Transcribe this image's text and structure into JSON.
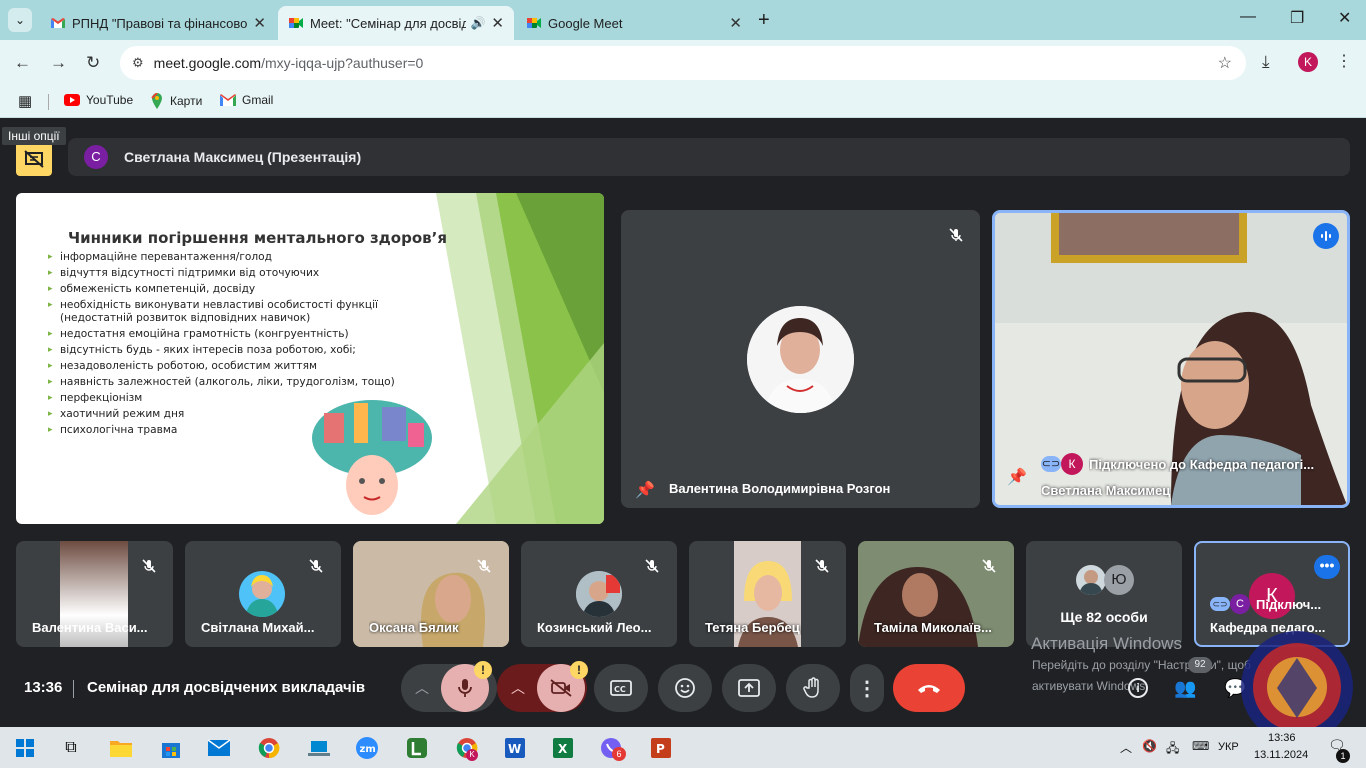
{
  "browser": {
    "tabs": [
      {
        "title": "РПНД \"Правові та фінансово-...",
        "favicon": "gmail-icon"
      },
      {
        "title": "Meet: \"Семінар для досвід",
        "favicon": "meet-icon",
        "audio": true
      },
      {
        "title": "Google Meet",
        "favicon": "meet-icon"
      }
    ],
    "url_host": "meet.google.com",
    "url_path": "/mxy-iqqa-ujp?authuser=0",
    "profile_letter": "K",
    "bookmarks": [
      {
        "label": "YouTube",
        "icon": "youtube-icon"
      },
      {
        "label": "Карти",
        "icon": "maps-icon"
      },
      {
        "label": "Gmail",
        "icon": "gmail-icon"
      }
    ],
    "tooltip": "Інші опції"
  },
  "meet": {
    "presenter_avatar": "С",
    "presenter_label": "Светлана Максимец (Презентація)",
    "slide": {
      "title": "Чинники погіршення ментального здоров’я",
      "items": [
        "інформаційне перевантаження/голод",
        "відчуття відсутності підтримки від оточуючих",
        "обмеженість компетенцій, досвіду",
        "необхідність виконувати невластиві особистості функції  (недостатній розвиток відповідних навичок)",
        "недостатня емоційна грамотність (конгруентність)",
        "відсутність будь - яких інтересів поза роботою, хобі;",
        "незадоволеність роботою, особистим життям",
        "наявність залежностей (алкоголь, ліки, трудоголізм, тощо)",
        "перфекціонізм",
        "хаотичний режим дня",
        "психологічна травма"
      ]
    },
    "main_tiles": [
      {
        "name": "Валентина Володимирівна Розгон"
      },
      {
        "name": "Светлана Максимец",
        "status": "Підключено до Кафедра педагогі...",
        "status_avatar": "К"
      }
    ],
    "strip": [
      {
        "name": "Валентина Васи..."
      },
      {
        "name": "Світлана Михай..."
      },
      {
        "name": "Оксана Бялик"
      },
      {
        "name": "Козинський Лео..."
      },
      {
        "name": "Тетяна Бербец"
      },
      {
        "name": "Таміла Миколаїв..."
      },
      {
        "name": "Ще 82 особи",
        "avatar_letter": "Ю"
      },
      {
        "name": "Кафедра педаго...",
        "status": "Підключ...",
        "avatar_letter": "К",
        "status_avatar": "С"
      }
    ],
    "time": "13:36",
    "meeting_title": "Семінар для досвідчених викладачів",
    "warn_mark": "!",
    "participants_count": "92",
    "chat_badge": "",
    "watermark_title": "Активація Windows",
    "watermark_line1": "Перейдіть до розділу \"Настройки\", щоб",
    "watermark_line2": "активувати Windows."
  },
  "taskbar": {
    "lang": "УКР",
    "time": "13:36",
    "date": "13.11.2024",
    "viber_badge": "6",
    "chrome_badge": "K",
    "notif_count": "1"
  },
  "colors": {
    "accent": "#8ab4f8",
    "leave": "#ea4335",
    "warn": "#fdd663"
  }
}
